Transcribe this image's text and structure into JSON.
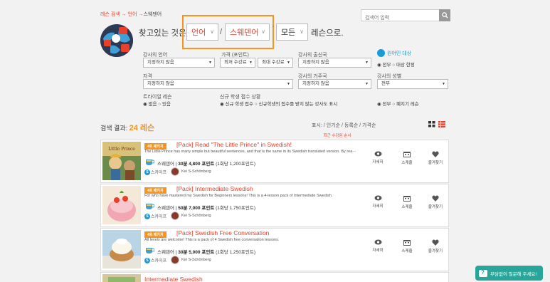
{
  "breadcrumb": {
    "home": "레슨 검색",
    "sep1": "→",
    "level1": "언어",
    "sep2": "→",
    "current": "스웨덴어"
  },
  "search": {
    "placeholder": "검색어 입력",
    "icon": "search-icon"
  },
  "headline": {
    "prefix": "찾고있는 것은",
    "category": "언어",
    "slash": "/",
    "language": "스웨덴어",
    "dot": "·",
    "level": "모든",
    "suffix": "레슨으로."
  },
  "filters": {
    "language_label": "강사의 언어",
    "language_value": "지정하지 않음",
    "price_label": "가격 (포인트)",
    "price_min": "최저 수강료",
    "price_max": "최대 수강료",
    "country_label": "강사의 출신국",
    "country_value": "지정하지 않음",
    "native_label": "원어민 대상",
    "native_opt1": "◉ 전부",
    "native_opt2": "○ 대상 한정",
    "qual_label": "자격",
    "qual_value": "지정하지 않음",
    "residence_label": "강사의 거주국",
    "residence_value": "지정하지 않음",
    "gender_label": "강사의 성별",
    "gender_value": "전부",
    "trial_label": "트라이얼 레슨",
    "trial_opt1": "◉ 없음",
    "trial_opt2": "○ 있음",
    "newstudent_label": "신규 학생 접수 상황",
    "newstudent_opt1": "◉ 신규 학생 접수",
    "newstudent_opt2": "○ 신규학생의 접수를 받지 않는 강사도 표시",
    "closed_opt1": "◉ 전부",
    "closed_opt2": "○ 폐지기 레슨"
  },
  "results": {
    "label": "검색 결과:",
    "count": "24 레슨",
    "sort_label": "표시:",
    "sort_active": "최근 수강된 순서",
    "sort_sep1": "/",
    "sort_2": "인기순",
    "sort_sep2": "/",
    "sort_3": "등록순",
    "sort_sep3": "/",
    "sort_4": "가격순"
  },
  "lessons": [
    {
      "badge": "4회 패키지",
      "title": "[Pack] Read \"The Little Prince\" in Swedish!",
      "desc": "The Little Prince has many simple but beautiful sentences, and that is the same in its Swedish translated version. By rea···",
      "lang": "스웨덴어",
      "duration": "30분",
      "price": "4,800 포인트",
      "per": "(1회당 1,200포인트)",
      "skype": "스카이프",
      "teacher": "Kei S-Schönberg"
    },
    {
      "badge": "4회 패키지",
      "title": "[Pack] Intermediate Swedish",
      "desc": "For who have mastered my Swedish for Beginners lessons! This is a 4-lesson pack of Intermediate Swedish.",
      "lang": "스웨덴어",
      "duration": "50분",
      "price": "7,000 포인트",
      "per": "(1회당 1,750포인트)",
      "skype": "스카이프",
      "teacher": "Kei S-Schönberg"
    },
    {
      "badge": "4회 패키지",
      "title": "[Pack] Swedish Free Conversation",
      "desc": "All levels are welcome! This is a pack of 4 Swedish free conversation lessons.",
      "lang": "스웨덴어",
      "duration": "30분",
      "price": "5,000 포인트",
      "per": "(1회당 1,250포인트)",
      "skype": "스카이프",
      "teacher": "Kei S-Schönberg"
    },
    {
      "title": "Intermediate Swedish"
    }
  ],
  "actions": {
    "detail": "자세히",
    "schedule": "스케줄",
    "favorite": "즐겨찾기"
  },
  "help": {
    "label": "부담없이 질문해 주세요!"
  },
  "colors": {
    "accent": "#e8402b",
    "orange": "#f7931e",
    "blue": "#1a9bd7",
    "teal": "#2aa59a"
  }
}
